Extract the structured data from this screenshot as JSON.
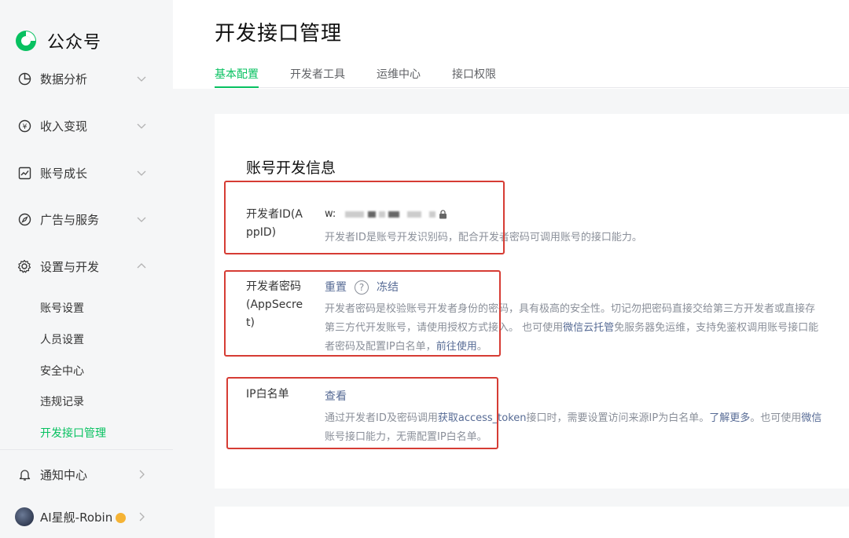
{
  "app": {
    "name": "公众号"
  },
  "sidebar": {
    "items": [
      {
        "label": "数据分析"
      },
      {
        "label": "收入变现"
      },
      {
        "label": "账号成长"
      },
      {
        "label": "广告与服务"
      },
      {
        "label": "设置与开发"
      }
    ],
    "sub_items": [
      {
        "label": "账号设置"
      },
      {
        "label": "人员设置"
      },
      {
        "label": "安全中心"
      },
      {
        "label": "违规记录"
      },
      {
        "label": "开发接口管理"
      }
    ],
    "notify": "通知中心",
    "user": "AI星舰-Robin"
  },
  "page": {
    "title": "开发接口管理"
  },
  "tabs": [
    {
      "label": "基本配置"
    },
    {
      "label": "开发者工具"
    },
    {
      "label": "运维中心"
    },
    {
      "label": "接口权限"
    }
  ],
  "section": {
    "title": "账号开发信息"
  },
  "appid": {
    "label": "开发者ID(AppID)",
    "value_prefix": "w:",
    "desc": "开发者ID是账号开发识别码，配合开发者密码可调用账号的接口能力。"
  },
  "secret": {
    "label": "开发者密码(AppSecret)",
    "reset": "重置",
    "help": "?",
    "freeze": "冻结",
    "desc1": "开发者密码是校验账号开发者身份的密码，具有极高的安全性。切记勿把密码直接交给第三方开发者或直接存",
    "desc2a": "第三方代开发账号，请使用授权方式接入。 也可使用",
    "desc2_link": "微信云托管",
    "desc2b": "免服务器免运维，支持免鉴权调用账号接口能",
    "desc3a": "者密码及配置IP白名单，",
    "desc3_link": "前往使用",
    "desc3b": "。"
  },
  "ip": {
    "label": "IP白名单",
    "view": "查看",
    "desc1a": "通过开发者ID及密码调用",
    "desc1_link": "获取access_token",
    "desc1b": "接口时，需要设置访问来源IP为白名单。",
    "desc1_link2": "了解更多",
    "desc1c": "。也可使用",
    "desc1_link3": "微信",
    "desc2": "账号接口能力，无需配置IP白名单。"
  },
  "colors": {
    "accent": "#07c160",
    "link": "#576b95",
    "highlight": "#d63c34"
  }
}
